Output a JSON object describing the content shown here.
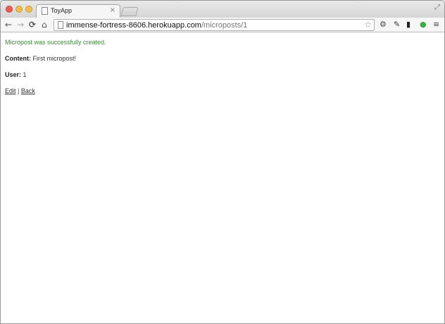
{
  "browser": {
    "tab_title": "ToyApp",
    "tab_close": "×",
    "url_host": "immense-fortress-8606.herokuapp.com",
    "url_path": "/microposts/1"
  },
  "page": {
    "notice": "Micropost was successfully created.",
    "content_label": "Content:",
    "content_value": "First micropost!",
    "user_label": "User:",
    "user_value": "1",
    "edit_link": "Edit",
    "separator": "|",
    "back_link": "Back"
  },
  "colors": {
    "notice": "#3a8f34",
    "close_light": "#ec5e55",
    "min_light": "#f4be4f"
  }
}
